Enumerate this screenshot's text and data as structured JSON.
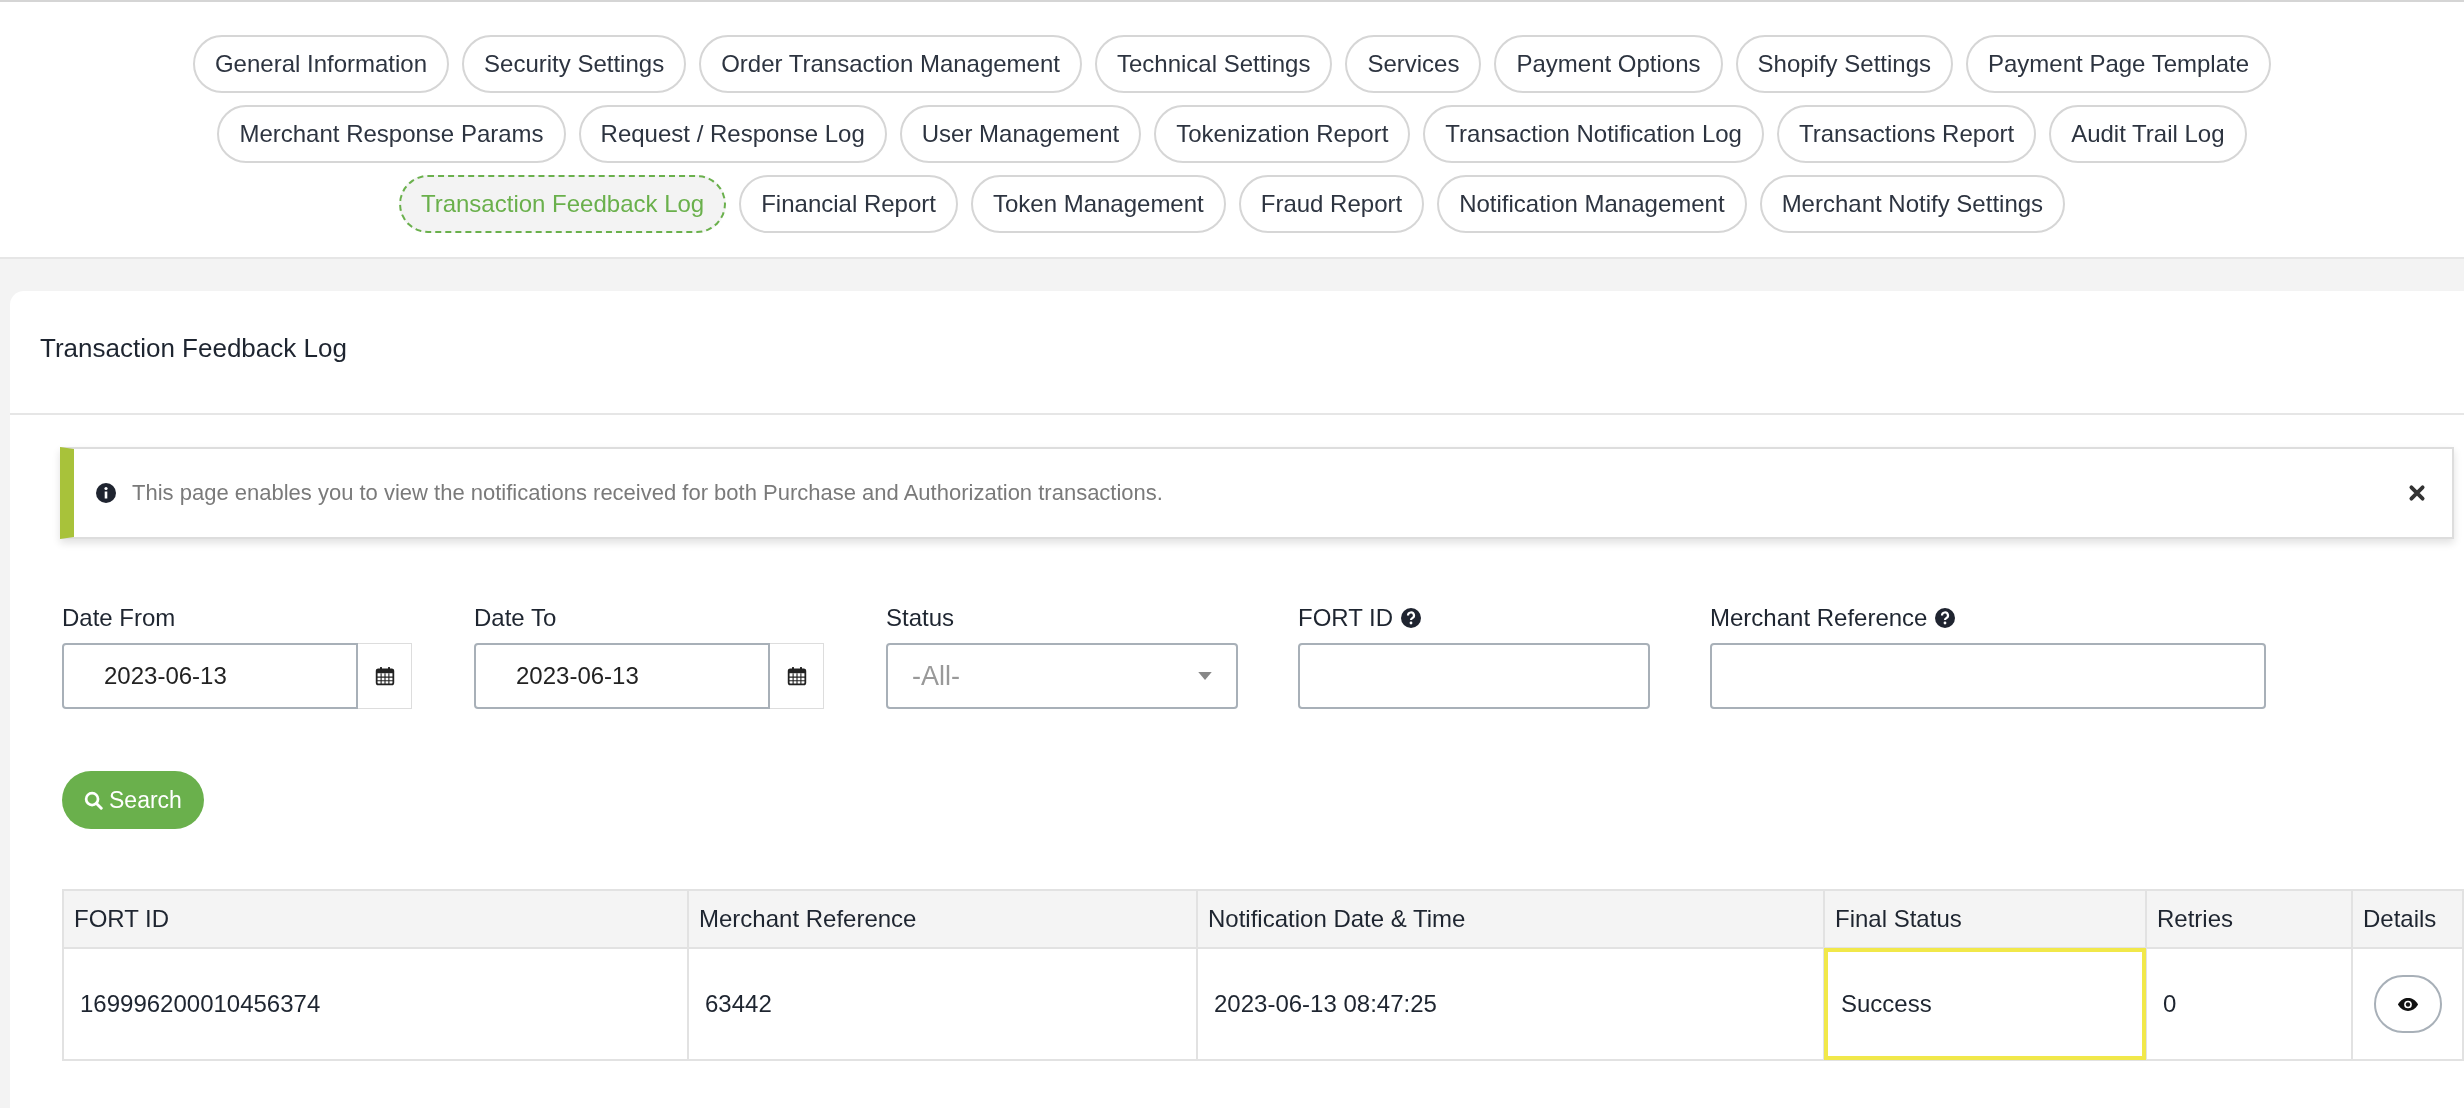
{
  "tab_rows": [
    [
      {
        "label": "General Information",
        "selected": false
      },
      {
        "label": "Security Settings",
        "selected": false
      },
      {
        "label": "Order Transaction Management",
        "selected": false
      },
      {
        "label": "Technical Settings",
        "selected": false
      },
      {
        "label": "Services",
        "selected": false
      },
      {
        "label": "Payment Options",
        "selected": false
      },
      {
        "label": "Shopify Settings",
        "selected": false
      },
      {
        "label": "Payment Page Template",
        "selected": false
      }
    ],
    [
      {
        "label": "Merchant Response Params",
        "selected": false
      },
      {
        "label": "Request / Response Log",
        "selected": false
      },
      {
        "label": "User Management",
        "selected": false
      },
      {
        "label": "Tokenization Report",
        "selected": false
      },
      {
        "label": "Transaction Notification Log",
        "selected": false
      },
      {
        "label": "Transactions Report",
        "selected": false
      },
      {
        "label": "Audit Trail Log",
        "selected": false
      }
    ],
    [
      {
        "label": "Transaction Feedback Log",
        "selected": true
      },
      {
        "label": "Financial Report",
        "selected": false
      },
      {
        "label": "Token Management",
        "selected": false
      },
      {
        "label": "Fraud Report",
        "selected": false
      },
      {
        "label": "Notification Management",
        "selected": false
      },
      {
        "label": "Merchant Notify Settings",
        "selected": false
      }
    ]
  ],
  "card": {
    "title": "Transaction Feedback Log",
    "alert": {
      "text": "This page enables you to view the notifications received for both Purchase and Authorization transactions."
    },
    "filters": [
      {
        "kind": "date",
        "label": "Date From",
        "value": "2023-06-13",
        "help": false
      },
      {
        "kind": "date",
        "label": "Date To",
        "value": "2023-06-13",
        "help": false
      },
      {
        "kind": "select",
        "label": "Status",
        "value": "-All-",
        "help": false
      },
      {
        "kind": "text",
        "label": "FORT ID",
        "help": true
      },
      {
        "kind": "text",
        "label": "Merchant Reference",
        "help": true
      }
    ],
    "search_button": "Search",
    "table": {
      "columns": [
        "FORT ID",
        "Merchant Reference",
        "Notification Date & Time",
        "Final Status",
        "Retries",
        "Details"
      ],
      "rows": [
        {
          "fort_id": "169996200010456374",
          "merchant_reference": "63442",
          "notification_date": "2023-06-13 08:47:25",
          "final_status": "Success",
          "status_highlighted": true,
          "retries": "0"
        }
      ]
    }
  }
}
